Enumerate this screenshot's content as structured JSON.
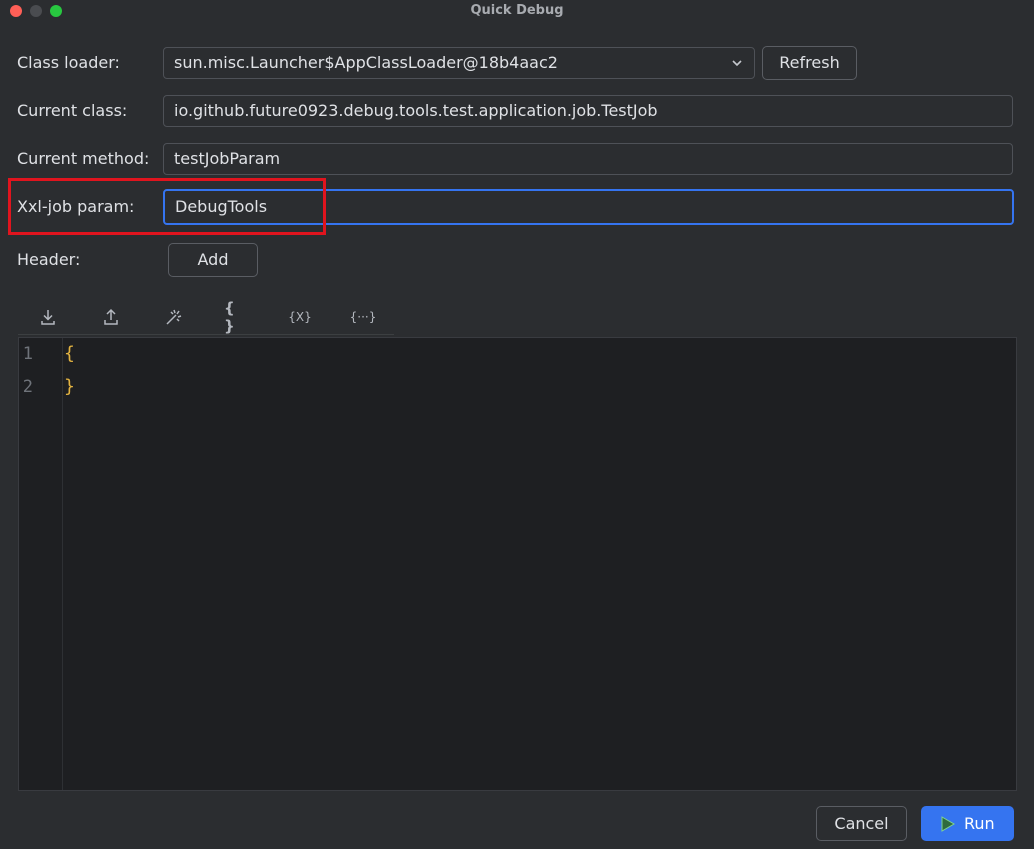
{
  "window": {
    "title": "Quick Debug"
  },
  "form": {
    "class_loader": {
      "label": "Class loader:",
      "value": "sun.misc.Launcher$AppClassLoader@18b4aac2"
    },
    "refresh_label": "Refresh",
    "current_class": {
      "label": "Current class:",
      "value": "io.github.future0923.debug.tools.test.application.job.TestJob"
    },
    "current_method": {
      "label": "Current method:",
      "value": "testJobParam"
    },
    "xxl_job_param": {
      "label": "Xxl-job param:",
      "value": "DebugTools"
    },
    "header": {
      "label": "Header:",
      "add_label": "Add"
    }
  },
  "toolbar": {
    "icons": [
      "import-icon",
      "export-icon",
      "magic-wand-icon",
      "braces-icon",
      "variable-icon",
      "ellipsis-braces-icon"
    ],
    "variable_glyph": "{X}",
    "ellipsis_glyph": "{···}"
  },
  "editor": {
    "lines": [
      {
        "number": "1",
        "text": "{"
      },
      {
        "number": "2",
        "text": "}"
      }
    ]
  },
  "footer": {
    "cancel_label": "Cancel",
    "run_label": "Run"
  },
  "colors": {
    "accent": "#3574f0",
    "highlight": "#e0141e",
    "bracket": "#e3b341"
  }
}
